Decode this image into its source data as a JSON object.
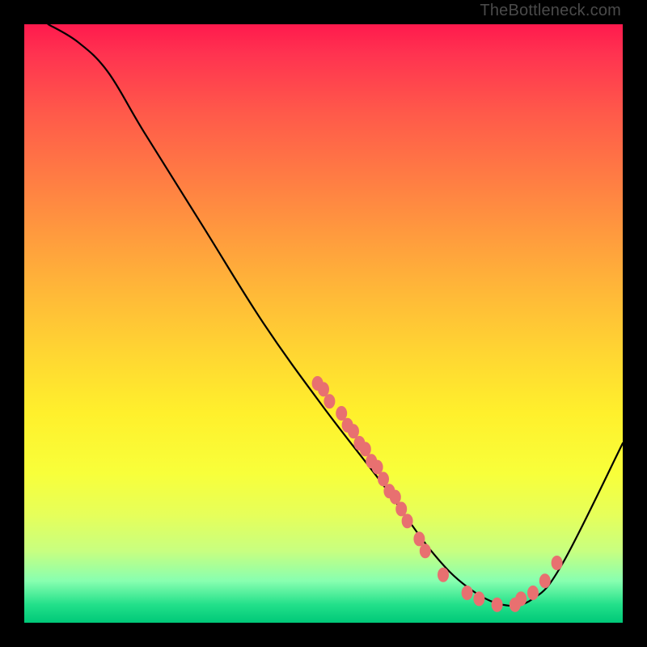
{
  "watermark": "TheBottleneck.com",
  "chart_data": {
    "type": "line",
    "title": "",
    "xlabel": "",
    "ylabel": "",
    "xlim": [
      0,
      100
    ],
    "ylim": [
      0,
      100
    ],
    "curve_points": [
      {
        "x": 4,
        "y": 100
      },
      {
        "x": 9,
        "y": 97
      },
      {
        "x": 14,
        "y": 92
      },
      {
        "x": 20,
        "y": 82
      },
      {
        "x": 30,
        "y": 66
      },
      {
        "x": 40,
        "y": 50
      },
      {
        "x": 50,
        "y": 36
      },
      {
        "x": 60,
        "y": 23
      },
      {
        "x": 68,
        "y": 12
      },
      {
        "x": 74,
        "y": 6
      },
      {
        "x": 80,
        "y": 3
      },
      {
        "x": 85,
        "y": 4
      },
      {
        "x": 90,
        "y": 10
      },
      {
        "x": 100,
        "y": 30
      }
    ],
    "marker_clusters": [
      {
        "x": 49,
        "y": 40
      },
      {
        "x": 50,
        "y": 39
      },
      {
        "x": 51,
        "y": 37
      },
      {
        "x": 53,
        "y": 35
      },
      {
        "x": 54,
        "y": 33
      },
      {
        "x": 55,
        "y": 32
      },
      {
        "x": 56,
        "y": 30
      },
      {
        "x": 57,
        "y": 29
      },
      {
        "x": 58,
        "y": 27
      },
      {
        "x": 59,
        "y": 26
      },
      {
        "x": 60,
        "y": 24
      },
      {
        "x": 61,
        "y": 22
      },
      {
        "x": 62,
        "y": 21
      },
      {
        "x": 63,
        "y": 19
      },
      {
        "x": 64,
        "y": 17
      },
      {
        "x": 66,
        "y": 14
      },
      {
        "x": 67,
        "y": 12
      },
      {
        "x": 70,
        "y": 8
      },
      {
        "x": 74,
        "y": 5
      },
      {
        "x": 76,
        "y": 4
      },
      {
        "x": 79,
        "y": 3
      },
      {
        "x": 82,
        "y": 3
      },
      {
        "x": 83,
        "y": 4
      },
      {
        "x": 85,
        "y": 5
      },
      {
        "x": 87,
        "y": 7
      },
      {
        "x": 89,
        "y": 10
      }
    ],
    "marker_color": "#e87070",
    "line_color": "#000000"
  }
}
